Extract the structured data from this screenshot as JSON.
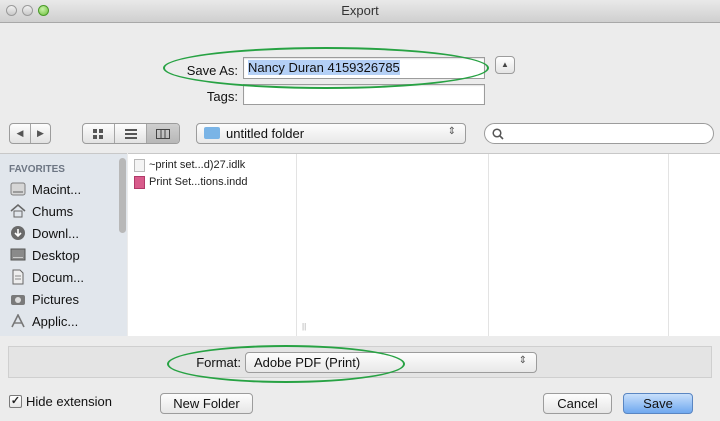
{
  "window": {
    "title": "Export"
  },
  "save_as": {
    "label": "Save As:",
    "value": "Nancy Duran 4159326785"
  },
  "tags": {
    "label": "Tags:",
    "value": ""
  },
  "toolbar": {
    "nav_back_icon": "triangle-left",
    "nav_forward_icon": "triangle-right",
    "view_modes": [
      "icon-view",
      "list-view",
      "column-view"
    ],
    "active_view": "column-view",
    "location": "untitled folder",
    "search_placeholder": ""
  },
  "sidebar": {
    "heading": "FAVORITES",
    "items": [
      {
        "label": "Macint...",
        "icon": "hard-drive-icon"
      },
      {
        "label": "Chums",
        "icon": "home-icon"
      },
      {
        "label": "Downl...",
        "icon": "downloads-icon"
      },
      {
        "label": "Desktop",
        "icon": "desktop-icon"
      },
      {
        "label": "Docum...",
        "icon": "documents-icon"
      },
      {
        "label": "Pictures",
        "icon": "pictures-icon"
      },
      {
        "label": "Applic...",
        "icon": "applications-icon"
      }
    ]
  },
  "files": [
    {
      "name": "~print set...d)27.idlk",
      "type": "idlk"
    },
    {
      "name": "Print Set...tions.indd",
      "type": "indd"
    }
  ],
  "format": {
    "label": "Format:",
    "value": "Adobe PDF (Print)"
  },
  "bottom": {
    "hide_extension_label": "Hide extension",
    "hide_extension_checked": true,
    "new_folder_label": "New Folder",
    "cancel_label": "Cancel",
    "save_label": "Save"
  },
  "colors": {
    "highlight_oval": "#27a243",
    "selection": "#b4d0f6",
    "default_button": "#6fa8ef"
  }
}
